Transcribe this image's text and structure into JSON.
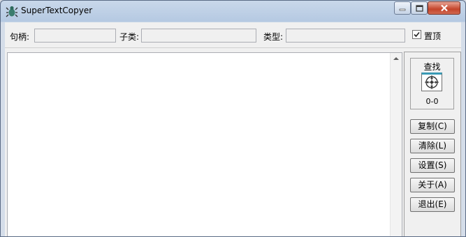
{
  "window": {
    "title": "SuperTextCopyer"
  },
  "toolbar": {
    "handle_label": "句柄:",
    "subclass_label": "子类:",
    "type_label": "类型:",
    "handle_value": "",
    "subclass_value": "",
    "type_value": "",
    "topmost_label": "置顶",
    "topmost_checked": true
  },
  "main_text": "",
  "side": {
    "finder_label": "查找",
    "coords": "0-0",
    "buttons": [
      "复制(C)",
      "清除(L)",
      "设置(S)",
      "关于(A)",
      "退出(E)"
    ]
  },
  "colors": {
    "finder_accent": "#3a9ab5",
    "close_button": "#c4442a"
  }
}
